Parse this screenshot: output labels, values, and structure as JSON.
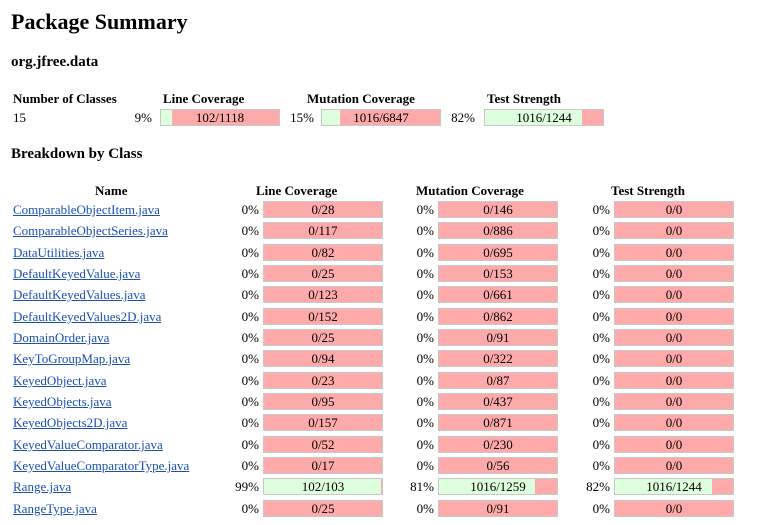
{
  "page": {
    "title": "Package Summary",
    "package_name": "org.jfree.data",
    "breakdown_title": "Breakdown by Class"
  },
  "summary": {
    "headers": {
      "classes": "Number of Classes",
      "line": "Line Coverage",
      "mutation": "Mutation Coverage",
      "strength": "Test Strength"
    },
    "classes": "15",
    "line": {
      "pct": "9%",
      "label": "102/1118",
      "fraction": 0.09
    },
    "mutation": {
      "pct": "15%",
      "label": "1016/6847",
      "fraction": 0.15
    },
    "strength": {
      "pct": "82%",
      "label": "1016/1244",
      "fraction": 0.82
    }
  },
  "breakdown": {
    "headers": {
      "name": "Name",
      "line": "Line Coverage",
      "mutation": "Mutation Coverage",
      "strength": "Test Strength"
    },
    "rows": [
      {
        "name": "ComparableObjectItem.java",
        "line": {
          "pct": "0%",
          "label": "0/28",
          "fraction": 0
        },
        "mutation": {
          "pct": "0%",
          "label": "0/146",
          "fraction": 0
        },
        "strength": {
          "pct": "0%",
          "label": "0/0",
          "fraction": 0
        }
      },
      {
        "name": "ComparableObjectSeries.java",
        "line": {
          "pct": "0%",
          "label": "0/117",
          "fraction": 0
        },
        "mutation": {
          "pct": "0%",
          "label": "0/886",
          "fraction": 0
        },
        "strength": {
          "pct": "0%",
          "label": "0/0",
          "fraction": 0
        }
      },
      {
        "name": "DataUtilities.java",
        "line": {
          "pct": "0%",
          "label": "0/82",
          "fraction": 0
        },
        "mutation": {
          "pct": "0%",
          "label": "0/695",
          "fraction": 0
        },
        "strength": {
          "pct": "0%",
          "label": "0/0",
          "fraction": 0
        }
      },
      {
        "name": "DefaultKeyedValue.java",
        "line": {
          "pct": "0%",
          "label": "0/25",
          "fraction": 0
        },
        "mutation": {
          "pct": "0%",
          "label": "0/153",
          "fraction": 0
        },
        "strength": {
          "pct": "0%",
          "label": "0/0",
          "fraction": 0
        }
      },
      {
        "name": "DefaultKeyedValues.java",
        "line": {
          "pct": "0%",
          "label": "0/123",
          "fraction": 0
        },
        "mutation": {
          "pct": "0%",
          "label": "0/661",
          "fraction": 0
        },
        "strength": {
          "pct": "0%",
          "label": "0/0",
          "fraction": 0
        }
      },
      {
        "name": "DefaultKeyedValues2D.java",
        "line": {
          "pct": "0%",
          "label": "0/152",
          "fraction": 0
        },
        "mutation": {
          "pct": "0%",
          "label": "0/862",
          "fraction": 0
        },
        "strength": {
          "pct": "0%",
          "label": "0/0",
          "fraction": 0
        }
      },
      {
        "name": "DomainOrder.java",
        "line": {
          "pct": "0%",
          "label": "0/25",
          "fraction": 0
        },
        "mutation": {
          "pct": "0%",
          "label": "0/91",
          "fraction": 0
        },
        "strength": {
          "pct": "0%",
          "label": "0/0",
          "fraction": 0
        }
      },
      {
        "name": "KeyToGroupMap.java",
        "line": {
          "pct": "0%",
          "label": "0/94",
          "fraction": 0
        },
        "mutation": {
          "pct": "0%",
          "label": "0/322",
          "fraction": 0
        },
        "strength": {
          "pct": "0%",
          "label": "0/0",
          "fraction": 0
        }
      },
      {
        "name": "KeyedObject.java",
        "line": {
          "pct": "0%",
          "label": "0/23",
          "fraction": 0
        },
        "mutation": {
          "pct": "0%",
          "label": "0/87",
          "fraction": 0
        },
        "strength": {
          "pct": "0%",
          "label": "0/0",
          "fraction": 0
        }
      },
      {
        "name": "KeyedObjects.java",
        "line": {
          "pct": "0%",
          "label": "0/95",
          "fraction": 0
        },
        "mutation": {
          "pct": "0%",
          "label": "0/437",
          "fraction": 0
        },
        "strength": {
          "pct": "0%",
          "label": "0/0",
          "fraction": 0
        }
      },
      {
        "name": "KeyedObjects2D.java",
        "line": {
          "pct": "0%",
          "label": "0/157",
          "fraction": 0
        },
        "mutation": {
          "pct": "0%",
          "label": "0/871",
          "fraction": 0
        },
        "strength": {
          "pct": "0%",
          "label": "0/0",
          "fraction": 0
        }
      },
      {
        "name": "KeyedValueComparator.java",
        "line": {
          "pct": "0%",
          "label": "0/52",
          "fraction": 0
        },
        "mutation": {
          "pct": "0%",
          "label": "0/230",
          "fraction": 0
        },
        "strength": {
          "pct": "0%",
          "label": "0/0",
          "fraction": 0
        }
      },
      {
        "name": "KeyedValueComparatorType.java",
        "line": {
          "pct": "0%",
          "label": "0/17",
          "fraction": 0
        },
        "mutation": {
          "pct": "0%",
          "label": "0/56",
          "fraction": 0
        },
        "strength": {
          "pct": "0%",
          "label": "0/0",
          "fraction": 0
        }
      },
      {
        "name": "Range.java",
        "line": {
          "pct": "99%",
          "label": "102/103",
          "fraction": 0.99
        },
        "mutation": {
          "pct": "81%",
          "label": "1016/1259",
          "fraction": 0.81
        },
        "strength": {
          "pct": "82%",
          "label": "1016/1244",
          "fraction": 0.82
        }
      },
      {
        "name": "RangeType.java",
        "line": {
          "pct": "0%",
          "label": "0/25",
          "fraction": 0
        },
        "mutation": {
          "pct": "0%",
          "label": "0/91",
          "fraction": 0
        },
        "strength": {
          "pct": "0%",
          "label": "0/0",
          "fraction": 0
        }
      }
    ]
  },
  "colors": {
    "covered": "#ddffdd",
    "uncovered": "#ffaaaa",
    "link": "#1a4fb4"
  }
}
